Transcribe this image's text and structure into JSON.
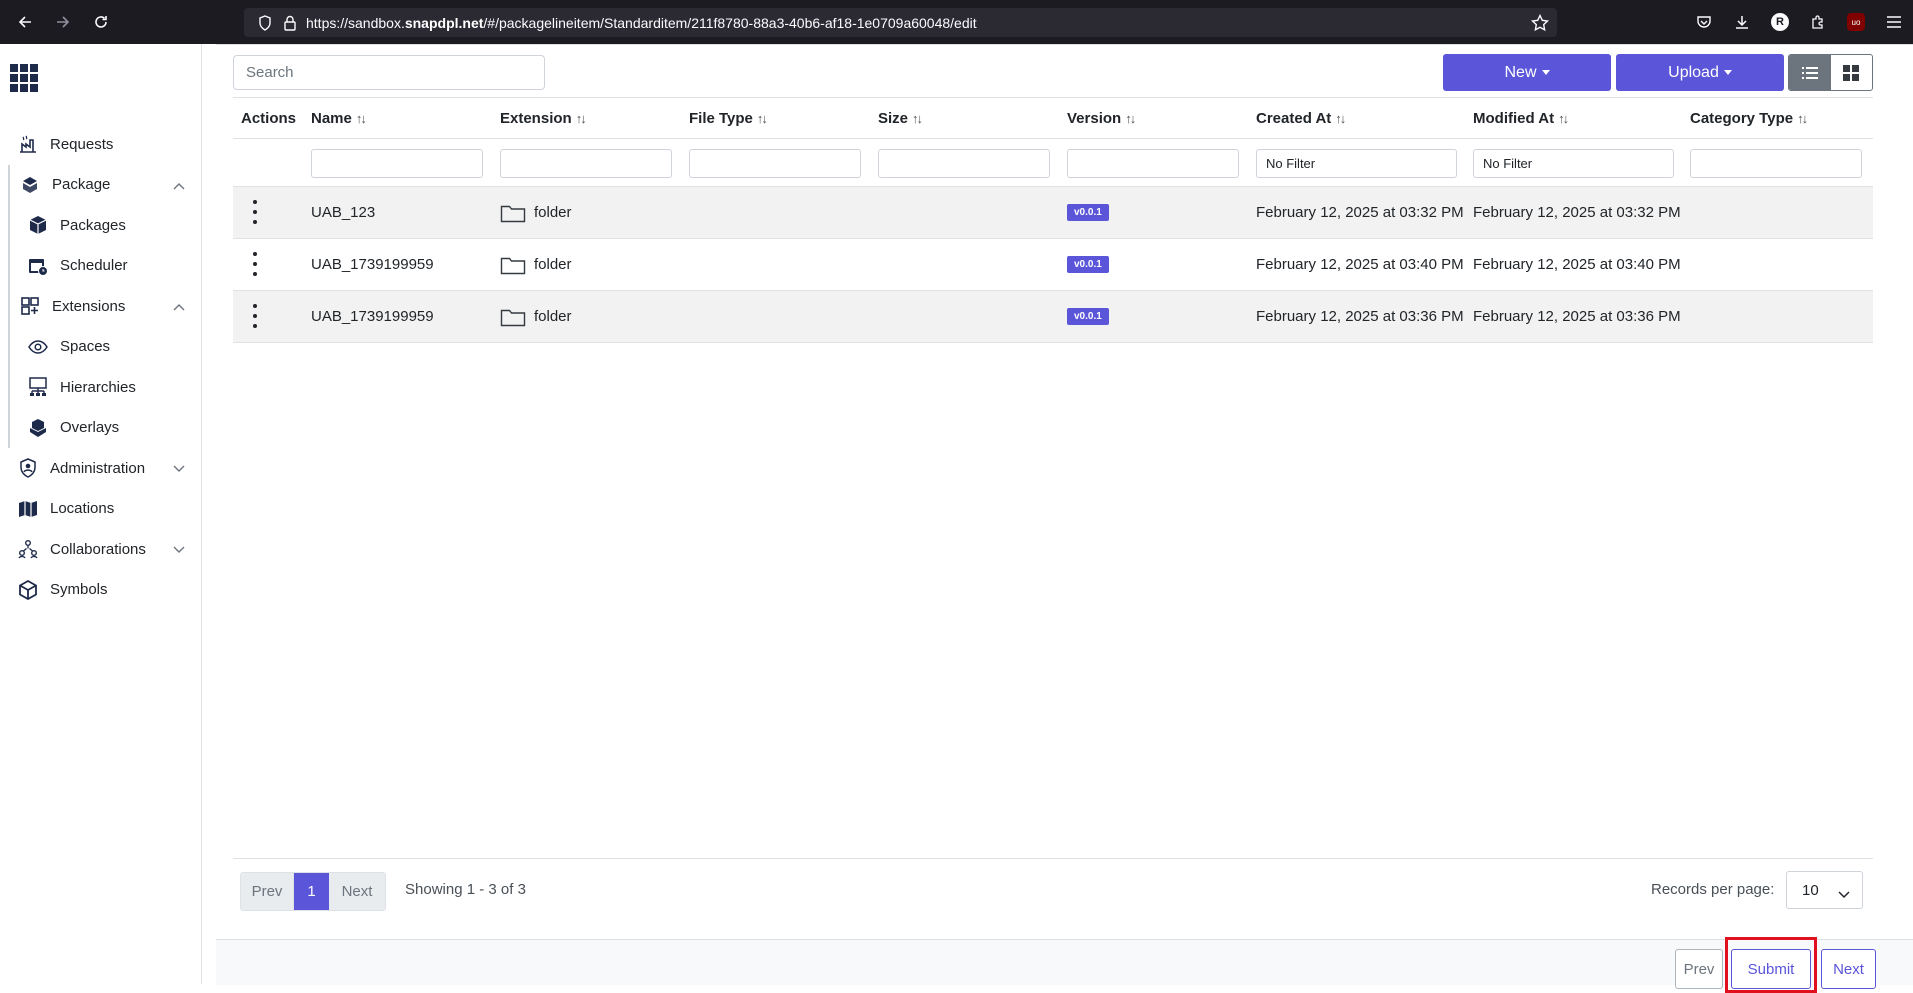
{
  "browser": {
    "url_prefix": "https://sandbox.",
    "url_domain": "snapdpl.net",
    "url_suffix": "/#/packagelineitem/Standarditem/211f8780-88a3-40b6-af18-1e0709a60048/edit",
    "profile_initial": "R",
    "extension_badge": "uo"
  },
  "sidebar": {
    "items": [
      {
        "label": "Requests",
        "icon": "requests-icon"
      },
      {
        "label": "Package",
        "icon": "package-icon"
      },
      {
        "label": "Packages",
        "icon": "box-icon"
      },
      {
        "label": "Scheduler",
        "icon": "calendar-icon"
      },
      {
        "label": "Extensions",
        "icon": "extensions-icon"
      },
      {
        "label": "Spaces",
        "icon": "eye-icon"
      },
      {
        "label": "Hierarchies",
        "icon": "hierarchy-icon"
      },
      {
        "label": "Overlays",
        "icon": "overlays-icon"
      },
      {
        "label": "Administration",
        "icon": "admin-icon"
      },
      {
        "label": "Locations",
        "icon": "map-icon"
      },
      {
        "label": "Collaborations",
        "icon": "collaborations-icon"
      },
      {
        "label": "Symbols",
        "icon": "cube-icon"
      }
    ]
  },
  "toolbar": {
    "search_placeholder": "Search",
    "new_label": "New",
    "upload_label": "Upload"
  },
  "table": {
    "headers": [
      "Actions",
      "Name",
      "Extension",
      "File Type",
      "Size",
      "Version",
      "Created At",
      "Modified At",
      "Category Type"
    ],
    "filters": {
      "created_at": "No Filter",
      "modified_at": "No Filter"
    },
    "rows": [
      {
        "name": "UAB_123",
        "extension": "folder",
        "version": "v0.0.1",
        "created": "February 12, 2025 at 03:32 PM",
        "modified": "February 12, 2025 at 03:32 PM"
      },
      {
        "name": "UAB_1739199959",
        "extension": "folder",
        "version": "v0.0.1",
        "created": "February 12, 2025 at 03:40 PM",
        "modified": "February 12, 2025 at 03:40 PM"
      },
      {
        "name": "UAB_1739199959",
        "extension": "folder",
        "version": "v0.0.1",
        "created": "February 12, 2025 at 03:36 PM",
        "modified": "February 12, 2025 at 03:36 PM"
      }
    ]
  },
  "pagination": {
    "prev": "Prev",
    "page": "1",
    "next": "Next",
    "showing": "Showing 1 - 3 of 3",
    "records_label": "Records per page:",
    "records_value": "10"
  },
  "footer": {
    "prev": "Prev",
    "submit": "Submit",
    "next": "Next"
  },
  "colors": {
    "accent": "#5a55d9",
    "highlight": "#e0101e"
  }
}
